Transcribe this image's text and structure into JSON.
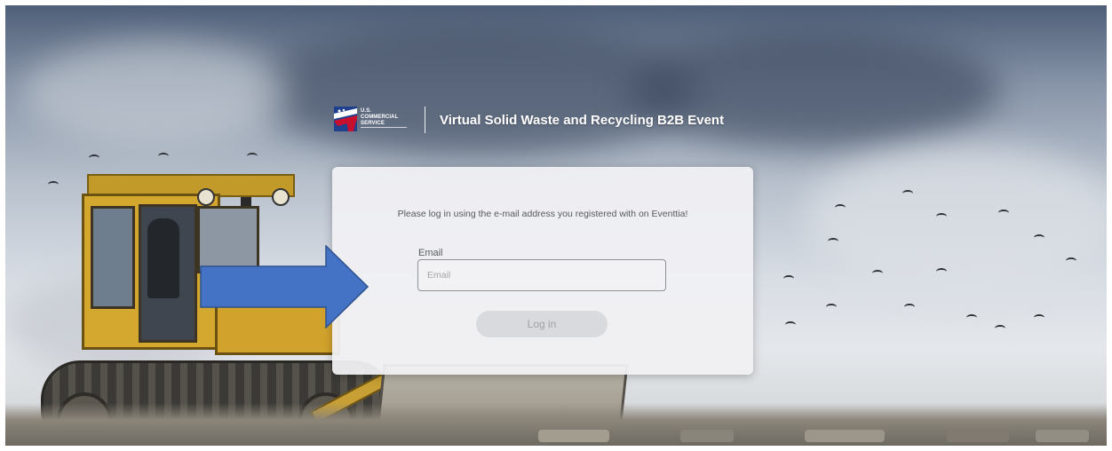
{
  "header": {
    "logo_text_line1": "U.S.",
    "logo_text_line2": "COMMERCIAL",
    "logo_text_line3": "SERVICE",
    "event_title": "Virtual Solid Waste and Recycling B2B Event"
  },
  "login": {
    "instructions": "Please log in using the e-mail address you registered with on Eventtia!",
    "email_label": "Email",
    "email_placeholder": "Email",
    "email_value": "",
    "login_button_label": "Log in"
  },
  "colors": {
    "arrow": "#4472c4",
    "card_background": "#f0f0f3",
    "button_background": "#d9dadd",
    "title_text": "#ffffff"
  },
  "icons": {
    "logo": "us-commercial-service-logo",
    "arrow": "right-arrow-annotation"
  }
}
